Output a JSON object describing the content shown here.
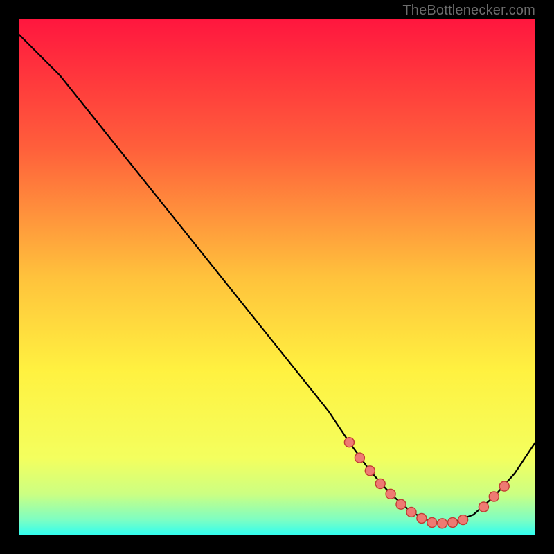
{
  "attribution": "TheBottlenecker.com",
  "colors": {
    "marker_fill": "#ee7a72",
    "marker_stroke": "#c23c34",
    "line": "#000000"
  },
  "chart_data": {
    "type": "line",
    "title": "",
    "xlabel": "",
    "ylabel": "",
    "xlim": [
      0,
      100
    ],
    "ylim": [
      0,
      100
    ],
    "x": [
      0,
      8,
      20,
      30,
      40,
      50,
      60,
      64,
      68,
      72,
      76,
      80,
      84,
      88,
      92,
      96,
      100
    ],
    "y": [
      97,
      89,
      74,
      61.5,
      49,
      36.5,
      24,
      18,
      12.5,
      8,
      4.5,
      2.5,
      2.5,
      4,
      7.5,
      12,
      18
    ],
    "markers": {
      "x": [
        64,
        66,
        68,
        70,
        72,
        74,
        76,
        78,
        80,
        82,
        84,
        86,
        90,
        92,
        94
      ],
      "y": [
        18,
        15,
        12.5,
        10,
        8,
        6,
        4.5,
        3.3,
        2.5,
        2.3,
        2.5,
        3,
        5.5,
        7.5,
        9.5
      ]
    },
    "background": {
      "kind": "vertical-gradient",
      "stops": [
        {
          "pct": 0,
          "color": "#ff163e"
        },
        {
          "pct": 25,
          "color": "#ff5f3b"
        },
        {
          "pct": 50,
          "color": "#ffc23c"
        },
        {
          "pct": 68,
          "color": "#fff140"
        },
        {
          "pct": 85,
          "color": "#f4ff5e"
        },
        {
          "pct": 92,
          "color": "#ccff82"
        },
        {
          "pct": 97,
          "color": "#7dfec3"
        },
        {
          "pct": 100,
          "color": "#2ffef1"
        }
      ]
    }
  }
}
